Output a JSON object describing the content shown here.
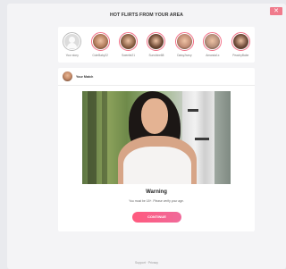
{
  "modal": {
    "close_label": "✕",
    "heading": "HOT FLIRTS FROM YOUR AREA"
  },
  "stories": [
    {
      "name": "Your story",
      "type": "add"
    },
    {
      "name": "CuteBaby22",
      "color": "#b07a5a"
    },
    {
      "name": "Sweetie21",
      "color": "#8c6246"
    },
    {
      "name": "Sunshine88",
      "color": "#6f4a36"
    },
    {
      "name": "Daisy2sexy",
      "color": "#c08b74"
    },
    {
      "name": "Amanda1x",
      "color": "#b58e7a"
    },
    {
      "name": "PeachyBabe",
      "color": "#704c3b"
    }
  ],
  "card": {
    "username": "Your Match",
    "warning_title": "Warning",
    "warning_text": "You must be 18+. Please verify your age.",
    "continue_label": "CONTINUE"
  },
  "footer": {
    "text": "Support · Privacy"
  },
  "colors": {
    "accent": "#ff5a7e",
    "close": "#f07b8c"
  }
}
